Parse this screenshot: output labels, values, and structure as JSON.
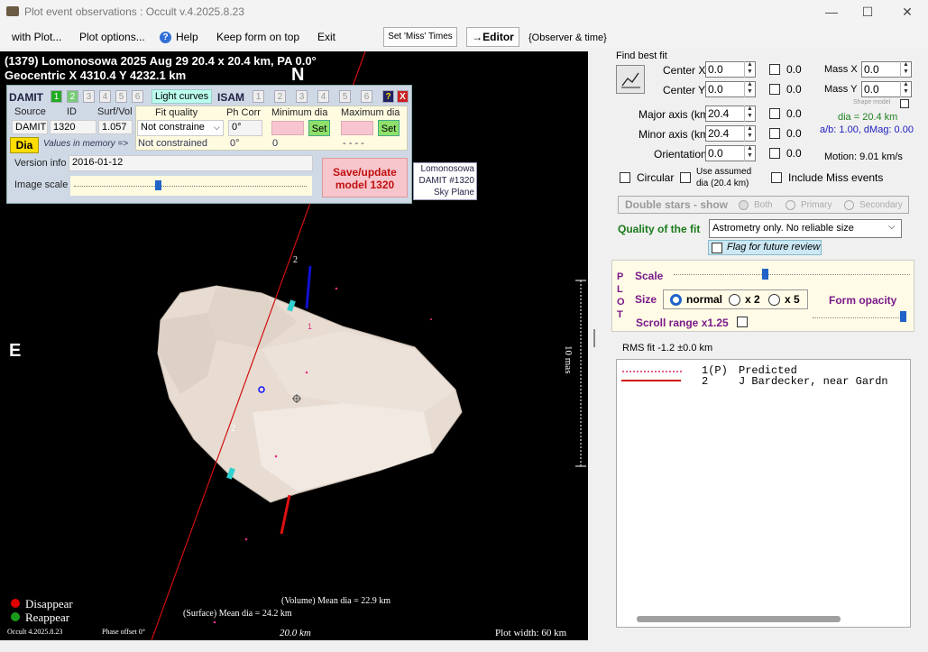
{
  "window": {
    "title": "Plot event observations : Occult v.4.2025.8.23",
    "minimize_icon": "—",
    "maximize_icon": "☐",
    "close_icon": "✕"
  },
  "menu": {
    "items": [
      "with Plot...",
      "Plot options...",
      "Help",
      "Keep form on top",
      "Exit"
    ]
  },
  "toolbar": {
    "set_miss": "Set 'Miss' Times",
    "editor": "→Editor",
    "observer": "{Observer & time}"
  },
  "plot": {
    "header1": "(1379) Lomonosowa  2025 Aug 29  20.4 x 20.4 km, PA 0.0°",
    "header2": "Geocentric  X 4310.4  Y 4232.1 km",
    "north": "N",
    "east": "E",
    "scale_label": "10 mas",
    "vol_dia": "(Volume) Mean dia = 22.9 km",
    "surf_dia": "(Surface) Mean dia = 24.2 km",
    "km_label": "20.0 km",
    "plot_width": "Plot width: 60 km",
    "version": "Occult 4.2025.8.23",
    "phase": "Phase offset 0°",
    "disappear": "Disappear",
    "reappear": "Reappear",
    "chord_label_1": "2",
    "chord_label_2": "2",
    "small_label": "1",
    "colors": {
      "disappear": "#e00000",
      "reappear": "#1a9a1a",
      "chord": "#e01010",
      "shape": "#e8dcd2"
    }
  },
  "damit": {
    "damit_label": "DAMIT",
    "num1": "1",
    "num2": "2",
    "nums_inactive": [
      "3",
      "4",
      "5",
      "6"
    ],
    "light_curves": "Light curves",
    "isam_label": "ISAM",
    "isam_nums": [
      "1",
      "2",
      "3",
      "4",
      "5",
      "6"
    ],
    "help": "?",
    "close": "X",
    "source_hdr": "Source",
    "id_hdr": "ID",
    "surfvol_hdr": "Surf/Vol",
    "source": "DAMIT",
    "id": "1320",
    "surfvol": "1.057",
    "fit_quality_hdr": "Fit quality",
    "ph_corr_hdr": "Ph Corr",
    "min_dia_hdr": "Minimum dia",
    "max_dia_hdr": "Maximum dia",
    "fit_quality": "Not constraine",
    "ph_corr": "0°",
    "set": "Set",
    "dia_btn": "Dia",
    "values_mem": "Values in memory =>",
    "not_constrained": "Not constrained",
    "mem_ph": "0°",
    "mem_min": "0",
    "mem_max": "- - - -",
    "version_label": "Version info",
    "version": "2016-01-12",
    "image_scale": "Image scale",
    "save_btn": "Save/update model 1320",
    "badge1": "Lomonosowa",
    "badge2": "DAMIT #1320",
    "badge3": "Sky Plane"
  },
  "fit": {
    "find_best_fit": "Find best fit",
    "center_x": "Center X",
    "center_y": "Center Y",
    "major": "Major axis (km)",
    "minor": "Minor axis (km)",
    "orientation": "Orientation",
    "cx": "0.0",
    "cy": "0.0",
    "maj": "20.4",
    "min": "20.4",
    "ori": "0.0",
    "res": [
      "0.0",
      "0.0",
      "0.0",
      "0.0",
      "0.0"
    ],
    "mass_x": "Mass X",
    "mass_y": "Mass Y",
    "mx": "0.0",
    "my": "0.0",
    "shape_model": "Shape model",
    "dia": "dia = 20.4 km",
    "ab": "a/b: 1.00, dMag: 0.00",
    "motion": "Motion: 9.01 km/s",
    "circular": "Circular",
    "use_assumed": "Use assumed",
    "use_assumed2": "dia (20.4 km)",
    "include_miss": "Include Miss events",
    "double_stars": "Double stars - show",
    "both": "Both",
    "primary": "Primary",
    "secondary": "Secondary",
    "quality": "Quality of the fit",
    "quality_val": "Astrometry only. No reliable size",
    "flag": "Flag for future review"
  },
  "plotopts": {
    "p": "P",
    "l": "L",
    "o": "O",
    "t": "T",
    "scale": "Scale",
    "size": "Size",
    "normal": "normal",
    "x2": "x 2",
    "x5": "x 5",
    "form_opacity": "Form opacity",
    "scroll_range": "Scroll range x1.25"
  },
  "legend": {
    "rms": "RMS fit -1.2 ±0.0 km",
    "rows": [
      {
        "num": "1(P)",
        "text": "Predicted"
      },
      {
        "num": "2",
        "text": "J Bardecker, near Gardn"
      }
    ]
  }
}
